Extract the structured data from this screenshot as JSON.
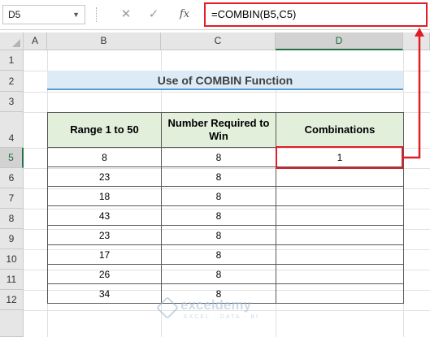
{
  "formula_bar": {
    "name_box": "D5",
    "cancel_symbol": "✕",
    "enter_symbol": "✓",
    "fx_label": "fx",
    "formula": "=COMBIN(B5,C5)"
  },
  "columns": [
    "A",
    "B",
    "C",
    "D"
  ],
  "selected_column": "D",
  "rows": [
    "1",
    "2",
    "3",
    "4",
    "5",
    "6",
    "7",
    "8",
    "9",
    "10",
    "11",
    "12"
  ],
  "selected_row": "5",
  "sheet_title": "Use of COMBIN Function",
  "table": {
    "headers": [
      "Range 1 to 50",
      "Number Required to Win",
      "Combinations"
    ],
    "rows": [
      [
        "8",
        "8",
        "1"
      ],
      [
        "23",
        "8",
        ""
      ],
      [
        "18",
        "8",
        ""
      ],
      [
        "43",
        "8",
        ""
      ],
      [
        "23",
        "8",
        ""
      ],
      [
        "17",
        "8",
        ""
      ],
      [
        "26",
        "8",
        ""
      ],
      [
        "34",
        "8",
        ""
      ]
    ]
  },
  "watermark": {
    "name": "exceldemy",
    "tagline": "EXCEL · DATA · BI"
  },
  "colors": {
    "highlight_red": "#e11d25",
    "title_fill": "#ddebf7",
    "header_fill": "#e2efda",
    "excel_green": "#217346"
  }
}
